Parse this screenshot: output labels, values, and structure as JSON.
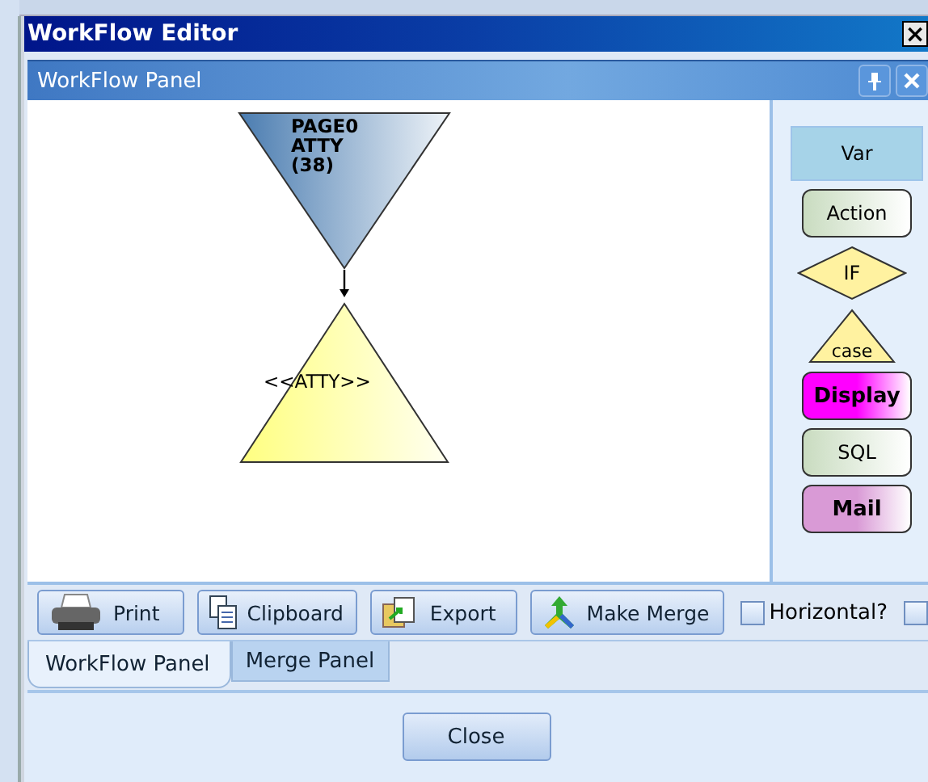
{
  "window": {
    "title": "WorkFlow Editor",
    "close": "×"
  },
  "panel": {
    "title": "WorkFlow Panel"
  },
  "diagram": {
    "nodes": [
      {
        "kind": "page",
        "lines": [
          "PAGE0",
          "ATTY",
          "  (38)"
        ]
      },
      {
        "kind": "merge",
        "lines": [
          "<<ATTY>>"
        ]
      }
    ]
  },
  "palette": [
    {
      "kind": "var",
      "label": "Var",
      "color": "#a6d3e8"
    },
    {
      "kind": "action",
      "label": "Action",
      "color": "#c9dcc0"
    },
    {
      "kind": "if",
      "label": "IF",
      "color": "#fff2a0"
    },
    {
      "kind": "case",
      "label": "case",
      "color": "#fff2a0"
    },
    {
      "kind": "display",
      "label": "Display",
      "color": "#ff00ff"
    },
    {
      "kind": "sql",
      "label": "SQL",
      "color": "#c9dcc0"
    },
    {
      "kind": "mail",
      "label": "Mail",
      "color": "#d99ad6"
    }
  ],
  "toolbar": [
    {
      "kind": "print",
      "label": "Print"
    },
    {
      "kind": "clipboard",
      "label": "Clipboard"
    },
    {
      "kind": "export",
      "label": "Export"
    },
    {
      "kind": "merge",
      "label": "Make Merge"
    }
  ],
  "options": [
    {
      "label": "Horizontal?",
      "checked": false
    },
    {
      "checked": false
    }
  ],
  "tabs": [
    {
      "label": "WorkFlow Panel",
      "selected": true
    },
    {
      "label": "Merge Panel",
      "selected": false
    }
  ],
  "buttons": [
    "Close"
  ]
}
